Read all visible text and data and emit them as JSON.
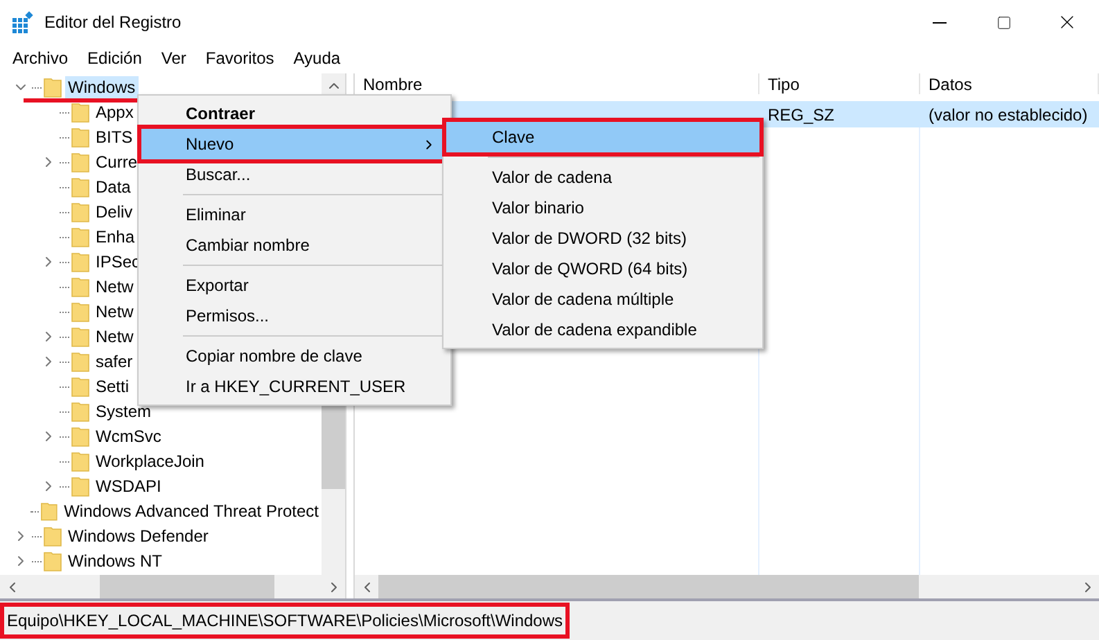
{
  "window": {
    "title": "Editor del Registro"
  },
  "menu_bar": [
    "Archivo",
    "Edición",
    "Ver",
    "Favoritos",
    "Ayuda"
  ],
  "tree": [
    {
      "label": "Windows",
      "expandable": true,
      "expanded": true,
      "selected": true,
      "children": [
        {
          "label": "Appx",
          "expandable": false,
          "selected": false
        },
        {
          "label": "BITS",
          "expandable": false,
          "selected": false
        },
        {
          "label": "Curre",
          "expandable": true,
          "expanded": false,
          "selected": false
        },
        {
          "label": "Data",
          "expandable": false,
          "selected": false
        },
        {
          "label": "Deliv",
          "expandable": false,
          "selected": false
        },
        {
          "label": "Enha",
          "expandable": false,
          "selected": false
        },
        {
          "label": "IPSec",
          "expandable": true,
          "expanded": false,
          "selected": false
        },
        {
          "label": "Netw",
          "expandable": false,
          "selected": false
        },
        {
          "label": "Netw",
          "expandable": false,
          "selected": false
        },
        {
          "label": "Netw",
          "expandable": true,
          "expanded": false,
          "selected": false
        },
        {
          "label": "safer",
          "expandable": true,
          "expanded": false,
          "selected": false
        },
        {
          "label": "Setti",
          "expandable": false,
          "selected": false
        },
        {
          "label": "System",
          "expandable": false,
          "selected": false
        },
        {
          "label": "WcmSvc",
          "expandable": true,
          "expanded": false,
          "selected": false
        },
        {
          "label": "WorkplaceJoin",
          "expandable": false,
          "selected": false
        },
        {
          "label": "WSDAPI",
          "expandable": true,
          "expanded": false,
          "selected": false
        }
      ]
    },
    {
      "label": "Windows Advanced Threat Protect",
      "expandable": false,
      "selected": false
    },
    {
      "label": "Windows Defender",
      "expandable": true,
      "expanded": false,
      "selected": false
    },
    {
      "label": "Windows NT",
      "expandable": true,
      "expanded": false,
      "selected": false
    }
  ],
  "values_table": {
    "columns": [
      "Nombre",
      "Tipo",
      "Datos"
    ],
    "rows": [
      {
        "tipo": "REG_SZ",
        "datos": "(valor no establecido)",
        "selected": true
      }
    ]
  },
  "context_menu": {
    "items": [
      {
        "kind": "item",
        "label": "Contraer",
        "default": true,
        "submenu": false,
        "selected": false
      },
      {
        "kind": "item",
        "label": "Nuevo",
        "default": false,
        "submenu": true,
        "selected": true
      },
      {
        "kind": "item",
        "label": "Buscar...",
        "default": false,
        "submenu": false,
        "selected": false
      },
      {
        "kind": "separator"
      },
      {
        "kind": "item",
        "label": "Eliminar",
        "default": false,
        "submenu": false,
        "selected": false
      },
      {
        "kind": "item",
        "label": "Cambiar nombre",
        "default": false,
        "submenu": false,
        "selected": false
      },
      {
        "kind": "separator"
      },
      {
        "kind": "item",
        "label": "Exportar",
        "default": false,
        "submenu": false,
        "selected": false
      },
      {
        "kind": "item",
        "label": "Permisos...",
        "default": false,
        "submenu": false,
        "selected": false
      },
      {
        "kind": "separator"
      },
      {
        "kind": "item",
        "label": "Copiar nombre de clave",
        "default": false,
        "submenu": false,
        "selected": false
      },
      {
        "kind": "item",
        "label": "Ir a HKEY_CURRENT_USER",
        "default": false,
        "submenu": false,
        "selected": false
      }
    ]
  },
  "submenu": {
    "items": [
      {
        "kind": "item",
        "label": "Clave",
        "selected": true
      },
      {
        "kind": "separator"
      },
      {
        "kind": "item",
        "label": "Valor de cadena",
        "selected": false
      },
      {
        "kind": "item",
        "label": "Valor binario",
        "selected": false
      },
      {
        "kind": "item",
        "label": "Valor de DWORD (32 bits)",
        "selected": false
      },
      {
        "kind": "item",
        "label": "Valor de QWORD (64 bits)",
        "selected": false
      },
      {
        "kind": "item",
        "label": "Valor de cadena múltiple",
        "selected": false
      },
      {
        "kind": "item",
        "label": "Valor de cadena expandible",
        "selected": false
      }
    ]
  },
  "status_bar": {
    "path": "Equipo\\HKEY_LOCAL_MACHINE\\SOFTWARE\\Policies\\Microsoft\\Windows"
  },
  "red_annotations": {
    "selected_key_underline": true,
    "context_menu_choice_frame": true,
    "submenu_choice_frame": true,
    "status_path_frame": true
  }
}
